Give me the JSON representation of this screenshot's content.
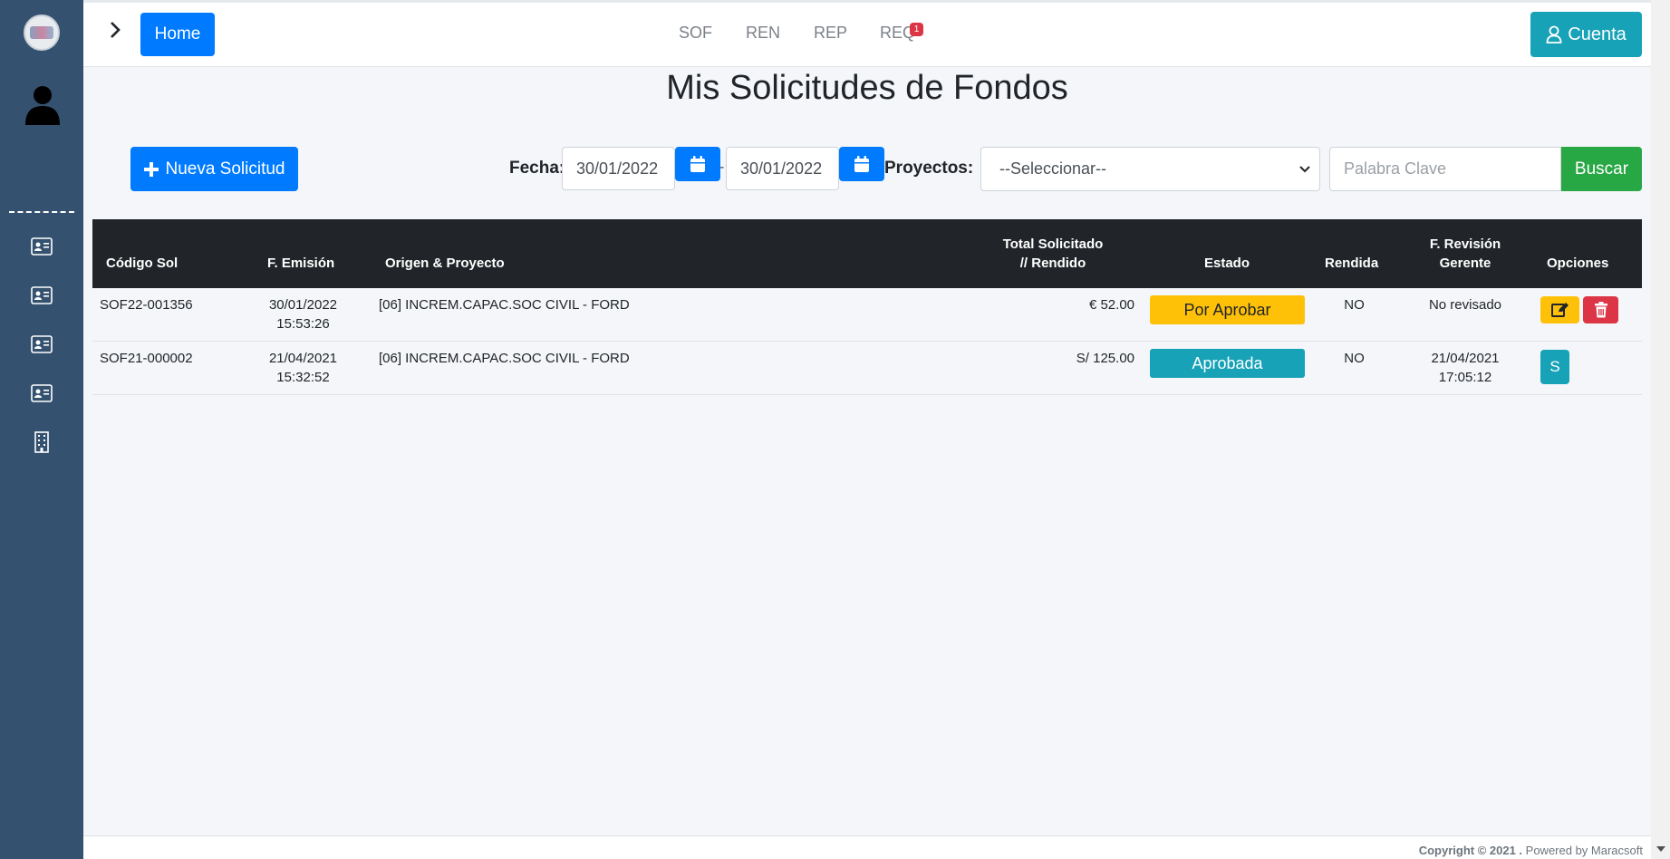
{
  "nav": {
    "home_label": "Home",
    "links": [
      "SOF",
      "REN",
      "REP",
      "REQ"
    ],
    "req_badge": "1",
    "account_label": "Cuenta"
  },
  "page": {
    "title": "Mis Solicitudes de Fondos"
  },
  "filters": {
    "new_label": "Nueva Solicitud",
    "date_label": "Fecha:",
    "date_from": "30/01/2022",
    "date_to": "30/01/2022",
    "separator": "-",
    "projects_label": "Proyectos:",
    "projects_selected": "--Seleccionar--",
    "keyword_placeholder": "Palabra Clave",
    "search_label": "Buscar"
  },
  "table": {
    "headers": {
      "code": "Código Sol",
      "emission": "F. Emisión",
      "origin": "Origen & Proyecto",
      "total_l1": "Total Solicitado",
      "total_l2": "// Rendido",
      "state": "Estado",
      "rendered": "Rendida",
      "review_l1": "F. Revisión",
      "review_l2": "Gerente",
      "options": "Opciones"
    },
    "rows": [
      {
        "code": "SOF22-001356",
        "date": "30/01/2022",
        "time": "15:53:26",
        "origin": "[06] INCREM.CAPAC.SOC CIVIL - FORD",
        "total": "€ 52.00",
        "state": "Por Aprobar",
        "rendered": "NO",
        "review_l1": "No revisado",
        "review_l2": ""
      },
      {
        "code": "SOF21-000002",
        "date": "21/04/2021",
        "time": "15:32:52",
        "origin": "[06] INCREM.CAPAC.SOC CIVIL - FORD",
        "total": "S/ 125.00",
        "state": "Aprobada",
        "rendered": "NO",
        "review_l1": "21/04/2021",
        "review_l2": "17:05:12",
        "option_label": "S"
      }
    ]
  },
  "footer": {
    "copyright": "Copyright © 2021 .",
    "powered": "Powered by Maracsoft"
  },
  "colors": {
    "sidebar": "#34516f",
    "primary": "#007bff",
    "info": "#17a2b8",
    "success": "#28a745",
    "warning": "#ffc107",
    "danger": "#dc3545",
    "table_header": "#212529"
  }
}
